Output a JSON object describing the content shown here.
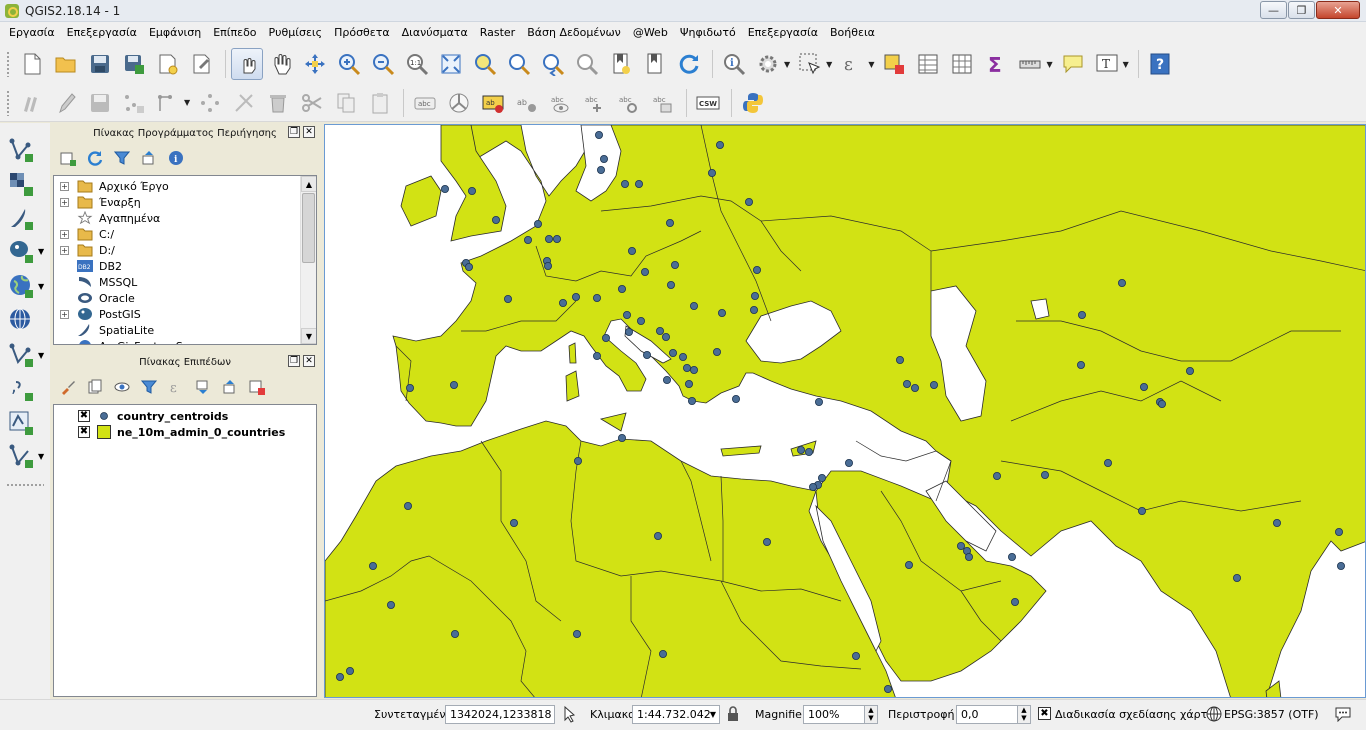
{
  "window": {
    "title": "QGIS2.18.14 - 1"
  },
  "menu": [
    "Εργασία",
    "Επεξεργασία",
    "Εμφάνιση",
    "Επίπεδο",
    "Ρυθμίσεις",
    "Πρόσθετα",
    "Διανύσματα",
    "Raster",
    "Βάση Δεδομένων",
    "@Web",
    "Ψηφιδωτό",
    "Επεξεργασία",
    "Βοήθεια"
  ],
  "icons": {
    "toolbar1": [
      "new-project-icon",
      "open-project-icon",
      "save-project-icon",
      "save-as-icon",
      "new-print-composer-icon",
      "composer-manager-icon",
      "touch-zoom-pan-icon",
      "pan-icon",
      "pan-to-selection-icon",
      "zoom-in-icon",
      "zoom-out-icon",
      "zoom-actual-size-icon",
      "zoom-full-icon",
      "zoom-to-selection-icon",
      "zoom-to-layer-icon",
      "zoom-last-icon",
      "zoom-next-icon",
      "new-bookmark-icon",
      "show-bookmarks-icon",
      "refresh-icon",
      "identify-icon",
      "run-feature-action-icon",
      "select-features-icon",
      "select-by-expression-icon",
      "deselect-all-icon",
      "attribute-table-icon",
      "field-calculator-icon",
      "statistical-summary-icon",
      "measure-icon",
      "map-tips-icon",
      "text-annotation-icon",
      "help-icon"
    ],
    "toolbar2": [
      "current-edits-icon",
      "toggle-editing-icon",
      "save-layer-edits-icon",
      "add-feature-icon",
      "move-feature-icon",
      "node-tool-icon",
      "delete-selected-icon",
      "cut-features-icon",
      "copy-features-icon",
      "paste-features-icon",
      "label-icon",
      "layer-labeling-icon",
      "pin-labels-icon",
      "highlight-pinned-icon",
      "show-hide-labels-icon",
      "move-label-icon",
      "rotate-label-icon",
      "change-label-icon",
      "csw-icon",
      "python-console-icon"
    ],
    "left": [
      "add-vector-layer-icon",
      "add-raster-layer-icon",
      "add-spatialite-layer-icon",
      "add-postgis-layer-icon",
      "add-wms-layer-icon",
      "add-wcs-layer-icon",
      "add-wfs-layer-icon",
      "add-delimited-text-icon",
      "add-virtual-layer-icon",
      "new-shapefile-icon"
    ]
  },
  "browser_panel": {
    "title": "Πίνακας Προγράμματος Περιήγησης",
    "items": [
      {
        "label": "Αρχικό Έργο",
        "icon": "folder-icon",
        "expandable": true
      },
      {
        "label": "Έναρξη",
        "icon": "folder-icon",
        "expandable": true
      },
      {
        "label": "Αγαπημένα",
        "icon": "star-icon",
        "expandable": false
      },
      {
        "label": "C:/",
        "icon": "folder-icon",
        "expandable": true
      },
      {
        "label": "D:/",
        "icon": "folder-icon",
        "expandable": true
      },
      {
        "label": "DB2",
        "icon": "db2-icon",
        "expandable": false
      },
      {
        "label": "MSSQL",
        "icon": "mssql-icon",
        "expandable": false
      },
      {
        "label": "Oracle",
        "icon": "oracle-icon",
        "expandable": false
      },
      {
        "label": "PostGIS",
        "icon": "postgis-icon",
        "expandable": true
      },
      {
        "label": "SpatiaLite",
        "icon": "spatialite-icon",
        "expandable": false
      },
      {
        "label": "ArcGisFeatureServer",
        "icon": "arcgis-icon",
        "expandable": false
      }
    ]
  },
  "layers_panel": {
    "title": "Πίνακας Επιπέδων",
    "layers": [
      {
        "name": "country_centroids",
        "checked": true,
        "symbol": "point",
        "color": "#4a6d96"
      },
      {
        "name": "ne_10m_admin_0_countries",
        "checked": true,
        "symbol": "polygon",
        "color": "#d2e214"
      }
    ]
  },
  "map": {
    "land_color": "#d2e214",
    "water_color": "#ffffff",
    "point_color": "#4a6d96",
    "border_color": "#2b2b2b"
  },
  "status": {
    "coordinate_label": "Συντεταγμένη",
    "coordinate_value": "1342024,1233818",
    "scale_label": "Κλιμακα",
    "scale_value": "1:44.732.042",
    "magnifier_label": "Magnifier",
    "magnifier_value": "100%",
    "rotation_label": "Περιστροφή",
    "rotation_value": "0,0",
    "render_label": "Διαδικασία σχεδίασης χάρτη",
    "render_checked": true,
    "crs": "EPSG:3857 (OTF)"
  }
}
